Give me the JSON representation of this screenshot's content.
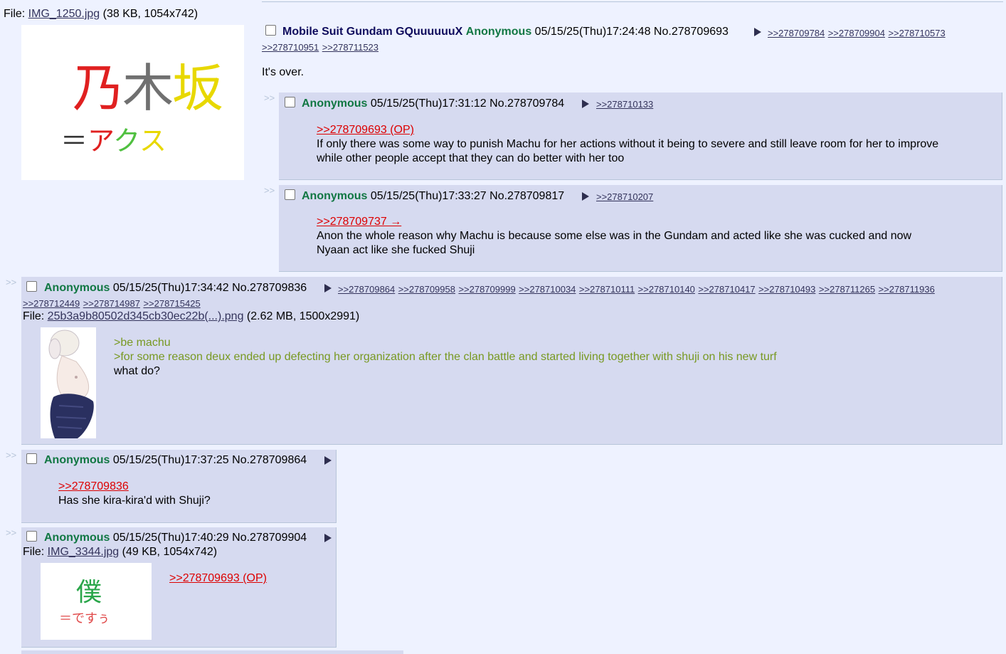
{
  "op": {
    "file_prefix": "File: ",
    "file_name": "IMG_1250.jpg",
    "file_info": "(38 KB, 1054x742)",
    "thumb_kanji": "乃木坂",
    "thumb_kana": "＝アクス",
    "subject": "Mobile Suit Gundam GQuuuuuuX",
    "name": "Anonymous",
    "datetime": "05/15/25(Thu)17:24:48",
    "postno": "No.278709693",
    "backlinks": [
      ">>278709784",
      ">>278709904",
      ">>278710573",
      ">>278710951",
      ">>278711523"
    ],
    "message": "It's over."
  },
  "r1": {
    "arrows": ">>",
    "name": "Anonymous",
    "datetime": "05/15/25(Thu)17:31:12",
    "postno": "No.278709784",
    "backlinks": [
      ">>278710133"
    ],
    "quote": ">>278709693 (OP)",
    "line1": "If only there was some way to punish Machu for her actions without it being to severe and still leave room for her to improve",
    "line2": "while other people accept that they can do better with her too"
  },
  "r2": {
    "arrows": ">>",
    "name": "Anonymous",
    "datetime": "05/15/25(Thu)17:33:27",
    "postno": "No.278709817",
    "backlinks": [
      ">>278710207"
    ],
    "quote": ">>278709737 →",
    "line1": "Anon the whole reason why Machu is because some else was in the Gundam and acted like she was cucked and now",
    "line2": "Nyaan act like she fucked Shuji"
  },
  "r3": {
    "arrows": ">>",
    "name": "Anonymous",
    "datetime": "05/15/25(Thu)17:34:42",
    "postno": "No.278709836",
    "backlinks": [
      ">>278709864",
      ">>278709958",
      ">>278709999",
      ">>278710034",
      ">>278710111",
      ">>278710140",
      ">>278710417",
      ">>278710493",
      ">>278711265",
      ">>278711936",
      ">>278712449",
      ">>278714987",
      ">>278715425"
    ],
    "file_prefix": "File: ",
    "file_name": "25b3a9b80502d345cb30ec22b(...).png",
    "file_info": "(2.62 MB, 1500x2991)",
    "green1": ">be machu",
    "green2": ">for some reason deux ended up defecting her organization after the clan battle and started living together with shuji on his new turf",
    "line3": "what do?"
  },
  "r4": {
    "arrows": ">>",
    "name": "Anonymous",
    "datetime": "05/15/25(Thu)17:37:25",
    "postno": "No.278709864",
    "quote": ">>278709836",
    "line1": "Has she kira-kira'd with Shuji?"
  },
  "r5": {
    "arrows": ">>",
    "name": "Anonymous",
    "datetime": "05/15/25(Thu)17:40:29",
    "postno": "No.278709904",
    "file_prefix": "File: ",
    "file_name": "IMG_3344.jpg",
    "file_info": "(49 KB, 1054x742)",
    "thumb_kanji": "僕",
    "thumb_kana": "＝ですぅ",
    "quote": ">>278709693 (OP)"
  },
  "colors": {
    "background": "#eef2ff",
    "reply_bg": "#d6daf0",
    "name": "#117743",
    "subject": "#0f0c5d",
    "quotelink": "#dd0000",
    "greentext": "#789922"
  }
}
